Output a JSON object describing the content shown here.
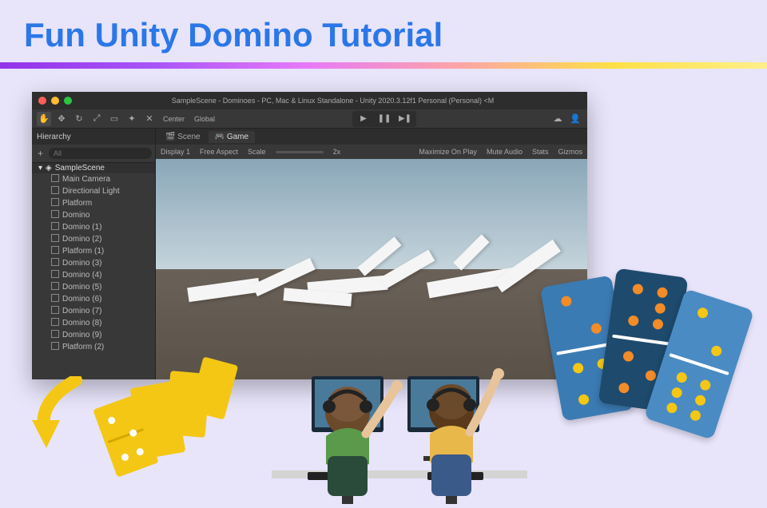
{
  "title": "Fun Unity Domino Tutorial",
  "unity": {
    "window_title": "SampleScene - Dominoes - PC, Mac & Linux Standalone - Unity 2020.3.12f1 Personal (Personal) <M",
    "toolbar": {
      "pivot": "Center",
      "handle": "Global"
    },
    "hierarchy": {
      "label": "Hierarchy",
      "search_placeholder": "All",
      "scene": "SampleScene",
      "items": [
        "Main Camera",
        "Directional Light",
        "Platform",
        "Domino",
        "Domino (1)",
        "Domino (2)",
        "Platform (1)",
        "Domino (3)",
        "Domino (4)",
        "Domino (5)",
        "Domino (6)",
        "Domino (7)",
        "Domino (8)",
        "Domino (9)",
        "Platform (2)"
      ]
    },
    "viewport": {
      "tabs": {
        "scene": "Scene",
        "game": "Game"
      },
      "display": "Display 1",
      "aspect": "Free Aspect",
      "scale_label": "Scale",
      "scale_value": "2x",
      "options": [
        "Maximize On Play",
        "Mute Audio",
        "Stats",
        "Gizmos"
      ]
    }
  }
}
